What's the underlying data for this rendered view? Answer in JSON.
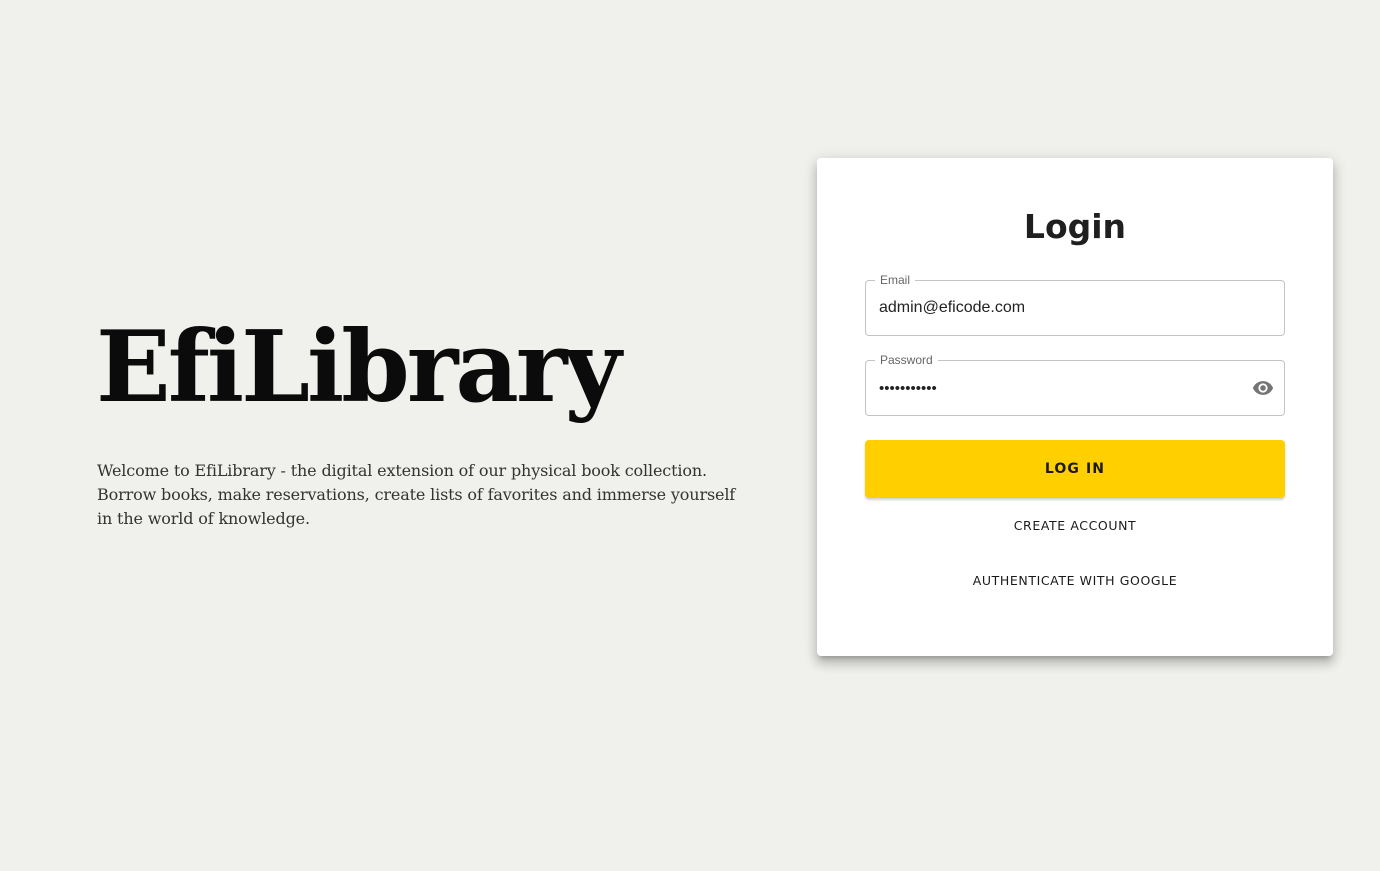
{
  "hero": {
    "title": "EfiLibrary",
    "description": "Welcome to EfiLibrary - the digital extension of our physical book collection. Borrow books, make reservations, create lists of favorites and immerse yourself in the world of knowledge."
  },
  "login": {
    "title": "Login",
    "email": {
      "label": "Email",
      "value": "admin@eficode.com"
    },
    "password": {
      "label": "Password",
      "value": "•••••••••••",
      "toggle_icon": "eye-icon"
    },
    "login_button": "LOG IN",
    "create_account_button": "CREATE ACCOUNT",
    "google_button": "AUTHENTICATE WITH GOOGLE"
  },
  "colors": {
    "background": "#f0f0ec",
    "card": "#ffffff",
    "accent": "#ffcf00",
    "text": "#1a1a1a"
  }
}
